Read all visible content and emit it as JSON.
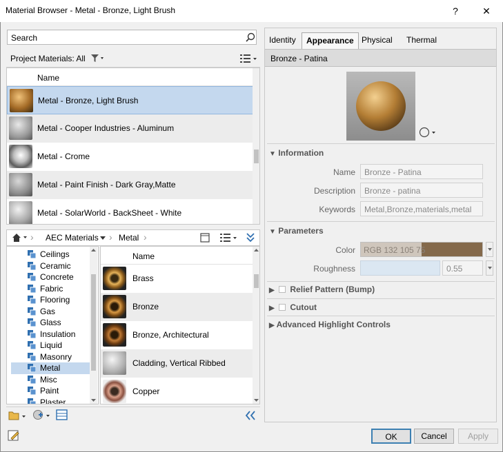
{
  "window": {
    "title": "Material Browser - Metal - Bronze, Light Brush",
    "help_glyph": "?",
    "close_glyph": "✕"
  },
  "search": {
    "placeholder": "Search"
  },
  "project_materials": {
    "label": "Project Materials: All"
  },
  "material_list": {
    "column_header": "Name",
    "rows": [
      {
        "name": "Metal - Bronze, Light Brush",
        "selected": true
      },
      {
        "name": "Metal - Cooper Industries - Aluminum"
      },
      {
        "name": "Metal - Crome"
      },
      {
        "name": "Metal - Paint Finish - Dark Gray,Matte"
      },
      {
        "name": "Metal - SolarWorld - BackSheet - White"
      }
    ]
  },
  "breadcrumb": {
    "items": [
      "AEC Materials",
      "Metal"
    ]
  },
  "library_tree": {
    "items": [
      "Ceilings",
      "Ceramic",
      "Concrete",
      "Fabric",
      "Flooring",
      "Gas",
      "Glass",
      "Insulation",
      "Liquid",
      "Masonry",
      "Metal",
      "Misc",
      "Paint",
      "Plaster"
    ],
    "selected": "Metal"
  },
  "library_list": {
    "column_header": "Name",
    "rows": [
      "Brass",
      "Bronze",
      "Bronze, Architectural",
      "Cladding, Vertical Ribbed",
      "Copper"
    ]
  },
  "tabs": [
    "Identity",
    "Appearance",
    "Physical",
    "Thermal"
  ],
  "active_tab": "Appearance",
  "asset_title": "Bronze - Patina",
  "information": {
    "header": "Information",
    "name_label": "Name",
    "name_value": "Bronze - Patina",
    "description_label": "Description",
    "description_value": "Bronze - patina",
    "keywords_label": "Keywords",
    "keywords_value": "Metal,Bronze,materials,metal"
  },
  "parameters": {
    "header": "Parameters",
    "color_label": "Color",
    "color_value": "RGB 132 105 75",
    "color_hex": "#84694b",
    "roughness_label": "Roughness",
    "roughness_value": "0.55"
  },
  "relief_pattern": {
    "header": "Relief Pattern (Bump)"
  },
  "cutout": {
    "header": "Cutout"
  },
  "advanced": {
    "header": "Advanced Highlight Controls"
  },
  "buttons": {
    "ok": "OK",
    "cancel": "Cancel",
    "apply": "Apply"
  }
}
